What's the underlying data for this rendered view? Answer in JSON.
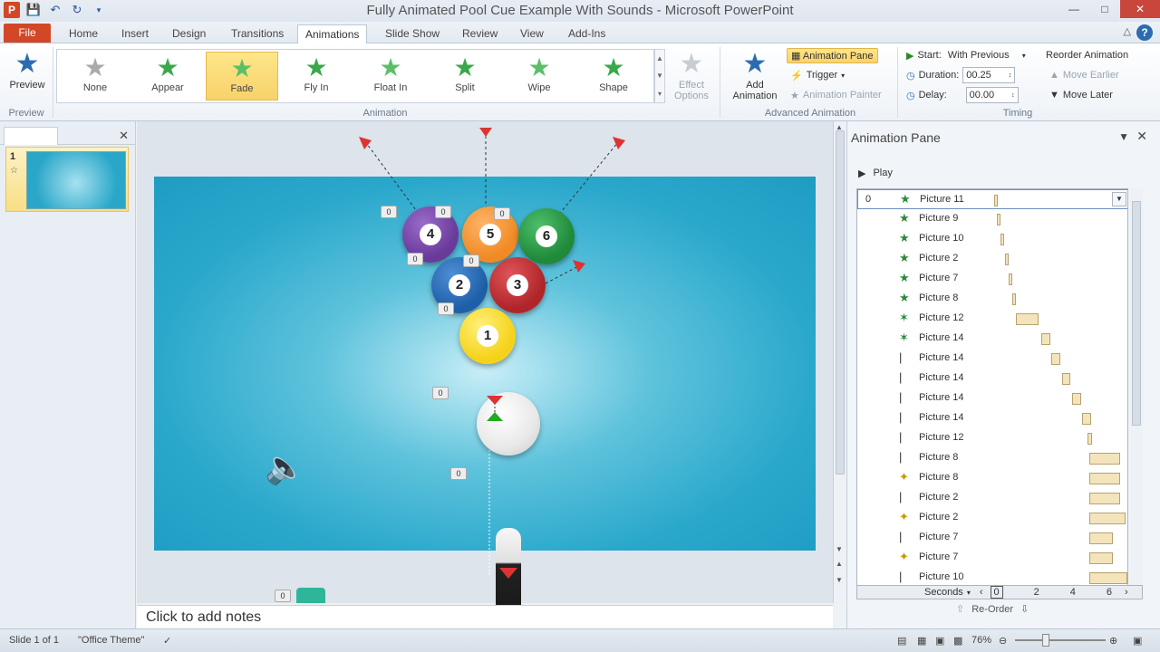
{
  "window": {
    "title": "Fully Animated Pool Cue Example With Sounds  -  Microsoft PowerPoint"
  },
  "tabs": [
    "File",
    "Home",
    "Insert",
    "Design",
    "Transitions",
    "Animations",
    "Slide Show",
    "Review",
    "View",
    "Add-Ins"
  ],
  "ribbon": {
    "preview": {
      "label": "Preview",
      "group": "Preview"
    },
    "animation_gallery": [
      "None",
      "Appear",
      "Fade",
      "Fly In",
      "Float In",
      "Split",
      "Wipe",
      "Shape"
    ],
    "effect_options": "Effect Options",
    "animation_group": "Animation",
    "add_animation": "Add Animation",
    "animation_pane": "Animation Pane",
    "trigger": "Trigger",
    "animation_painter": "Animation Painter",
    "advanced_group": "Advanced Animation",
    "start_label": "Start:",
    "start_value": "With Previous",
    "duration_label": "Duration:",
    "duration_value": "00.25",
    "delay_label": "Delay:",
    "delay_value": "00.00",
    "reorder": "Reorder Animation",
    "move_earlier": "Move Earlier",
    "move_later": "Move Later",
    "timing_group": "Timing"
  },
  "thumbnails": {
    "slide_number": "1"
  },
  "slide": {
    "balls": [
      {
        "num": "4",
        "color": "#6a3a9a"
      },
      {
        "num": "5",
        "color": "#f08a24"
      },
      {
        "num": "6",
        "color": "#1f8a3a"
      },
      {
        "num": "2",
        "color": "#1f5fa8"
      },
      {
        "num": "3",
        "color": "#b0252a"
      },
      {
        "num": "1",
        "color": "#f5d21a"
      }
    ],
    "tag_label": "0"
  },
  "notes_placeholder": "Click to add notes",
  "animation_pane": {
    "title": "Animation Pane",
    "play": "Play",
    "first_num": "0",
    "items": [
      {
        "name": "Picture 11",
        "icon": "entrance",
        "bar_start": 0.0,
        "bar_len": 0.02
      },
      {
        "name": "Picture 9",
        "icon": "entrance",
        "bar_start": 0.03,
        "bar_len": 0.02
      },
      {
        "name": "Picture 10",
        "icon": "entrance",
        "bar_start": 0.06,
        "bar_len": 0.02
      },
      {
        "name": "Picture 2",
        "icon": "entrance",
        "bar_start": 0.09,
        "bar_len": 0.02
      },
      {
        "name": "Picture 7",
        "icon": "entrance",
        "bar_start": 0.12,
        "bar_len": 0.02
      },
      {
        "name": "Picture 8",
        "icon": "entrance",
        "bar_start": 0.15,
        "bar_len": 0.02
      },
      {
        "name": "Picture 12",
        "icon": "motion",
        "bar_start": 0.18,
        "bar_len": 0.18
      },
      {
        "name": "Picture 14",
        "icon": "motion",
        "bar_start": 0.38,
        "bar_len": 0.07
      },
      {
        "name": "Picture 14",
        "icon": "path",
        "bar_start": 0.46,
        "bar_len": 0.07
      },
      {
        "name": "Picture 14",
        "icon": "path",
        "bar_start": 0.54,
        "bar_len": 0.07
      },
      {
        "name": "Picture 14",
        "icon": "path",
        "bar_start": 0.62,
        "bar_len": 0.07
      },
      {
        "name": "Picture 14",
        "icon": "path",
        "bar_start": 0.7,
        "bar_len": 0.07
      },
      {
        "name": "Picture 12",
        "icon": "path",
        "bar_start": 0.74,
        "bar_len": 0.04
      },
      {
        "name": "Picture 8",
        "icon": "path",
        "bar_start": 0.76,
        "bar_len": 0.24
      },
      {
        "name": "Picture 8",
        "icon": "emphasis",
        "bar_start": 0.76,
        "bar_len": 0.24
      },
      {
        "name": "Picture 2",
        "icon": "path",
        "bar_start": 0.76,
        "bar_len": 0.24
      },
      {
        "name": "Picture 2",
        "icon": "emphasis",
        "bar_start": 0.76,
        "bar_len": 0.28
      },
      {
        "name": "Picture 7",
        "icon": "path",
        "bar_start": 0.76,
        "bar_len": 0.18
      },
      {
        "name": "Picture 7",
        "icon": "emphasis",
        "bar_start": 0.76,
        "bar_len": 0.18
      },
      {
        "name": "Picture 10",
        "icon": "path",
        "bar_start": 0.76,
        "bar_len": 0.3
      }
    ],
    "timeline_label": "Seconds",
    "timeline_ticks": [
      "0",
      "2",
      "4",
      "6"
    ],
    "reorder": "Re-Order"
  },
  "status": {
    "slide": "Slide 1 of 1",
    "theme": "\"Office Theme\"",
    "zoom": "76%"
  }
}
